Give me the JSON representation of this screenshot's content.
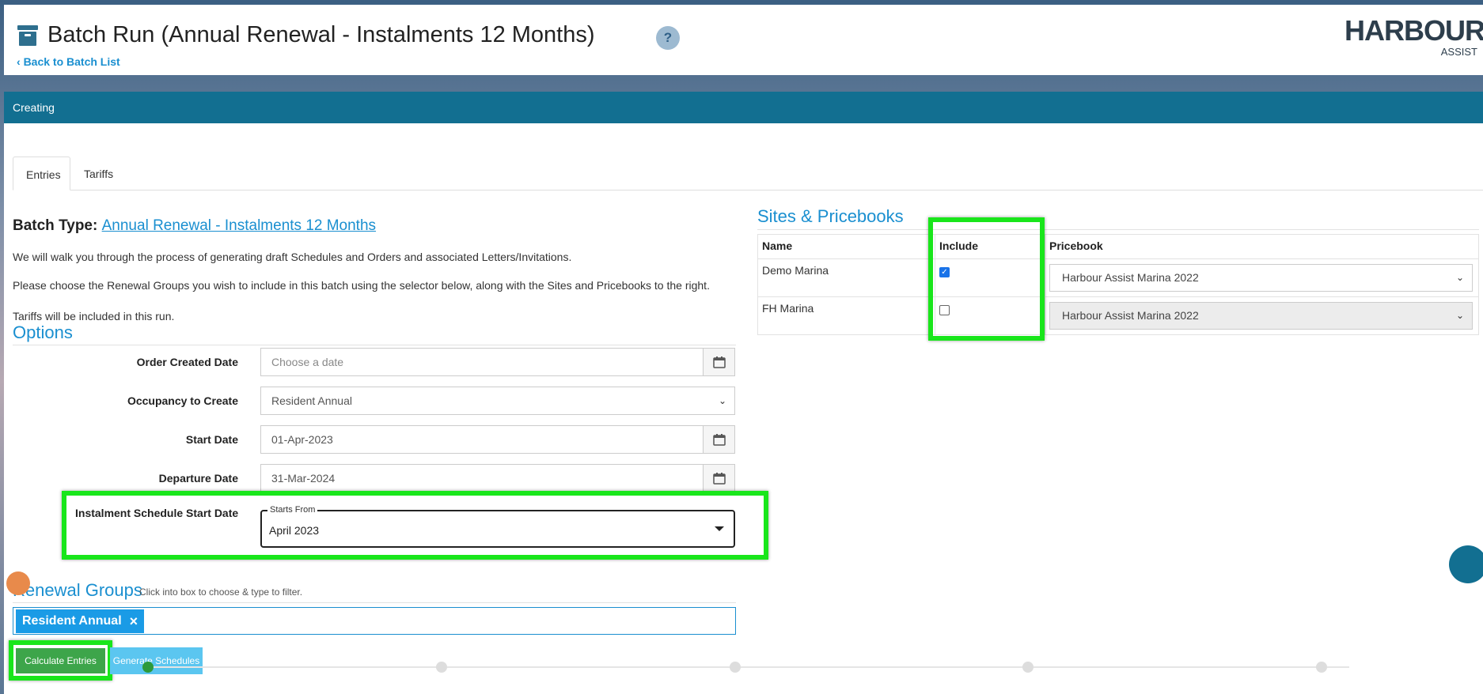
{
  "header": {
    "title": "Batch Run (Annual Renewal - Instalments 12 Months)",
    "back_label": "Back to Batch List",
    "help_label": "?",
    "logo_main": "HARBOUR",
    "logo_sub": "ASSIST"
  },
  "status": {
    "label": "Creating"
  },
  "tabs": [
    {
      "label": "Entries",
      "active": true
    },
    {
      "label": "Tariffs",
      "active": false
    }
  ],
  "batch": {
    "type_label": "Batch Type:",
    "type_value": "Annual Renewal - Instalments 12 Months",
    "para1": "We will walk you through the process of generating draft Schedules and Orders and associated Letters/Invitations.",
    "para2": "Please choose the Renewal Groups you wish to include in this batch using the selector below, along with the Sites and Pricebooks to the right.",
    "para3": "Tariffs will be included in this run."
  },
  "options": {
    "title": "Options",
    "order_created_label": "Order Created Date",
    "order_created_placeholder": "Choose a date",
    "occupancy_label": "Occupancy to Create",
    "occupancy_value": "Resident Annual",
    "start_label": "Start Date",
    "start_value": "01-Apr-2023",
    "departure_label": "Departure Date",
    "departure_value": "31-Mar-2024",
    "instalment_label": "Instalment Schedule Start Date",
    "instalment_legend": "Starts From",
    "instalment_value": "April 2023"
  },
  "renewal": {
    "title": "Renewal Groups",
    "hint": "Click into box to choose & type to filter.",
    "tag": "Resident Annual",
    "tag_remove": "×"
  },
  "buttons": {
    "calculate": "Calculate Entries",
    "generate": "Generate Schedules"
  },
  "sites": {
    "title": "Sites & Pricebooks",
    "headers": [
      "Name",
      "Include",
      "Pricebook"
    ],
    "rows": [
      {
        "name": "Demo Marina",
        "include": true,
        "pricebook": "Harbour Assist Marina 2022"
      },
      {
        "name": "FH Marina",
        "include": false,
        "pricebook": "Harbour Assist Marina 2022"
      }
    ]
  },
  "colors": {
    "accent": "#1a8fd0",
    "status_bar": "#126f91",
    "highlight": "#19e61b",
    "calc_button": "#3da54a",
    "generate_button": "#5bc6f0"
  },
  "icons": [
    "archive-icon",
    "help-icon",
    "chevron-left-icon",
    "calendar-icon",
    "chevron-down-icon",
    "caret-down-icon",
    "close-icon",
    "bell-icon"
  ]
}
